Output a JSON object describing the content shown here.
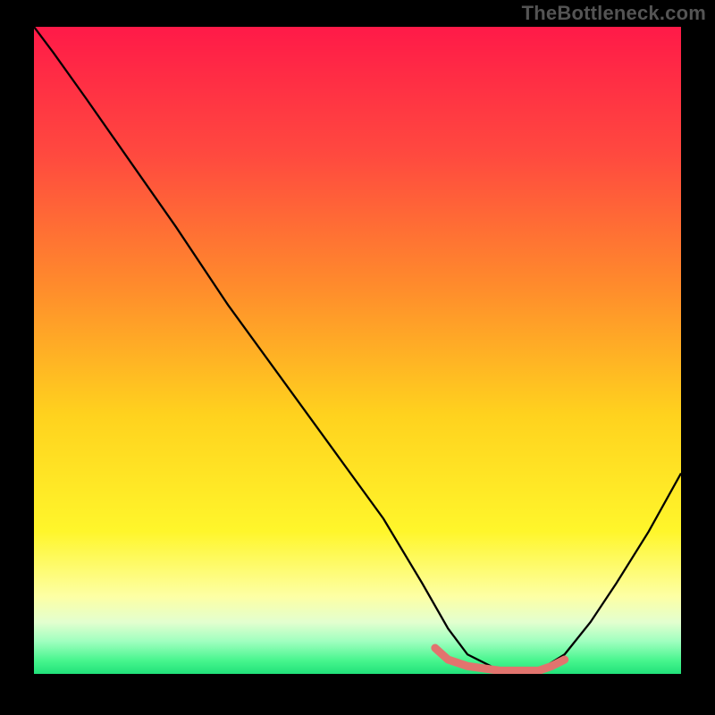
{
  "watermark": "TheBottleneck.com",
  "chart_data": {
    "type": "line",
    "title": "",
    "xlabel": "",
    "ylabel": "",
    "xlim": [
      0,
      100
    ],
    "ylim": [
      0,
      100
    ],
    "grid": false,
    "legend": false,
    "gradient_stops": [
      {
        "offset": 0,
        "color": "#ff1a48"
      },
      {
        "offset": 20,
        "color": "#ff4a3f"
      },
      {
        "offset": 40,
        "color": "#ff8b2c"
      },
      {
        "offset": 60,
        "color": "#ffd21e"
      },
      {
        "offset": 78,
        "color": "#fff62b"
      },
      {
        "offset": 88,
        "color": "#fdffa4"
      },
      {
        "offset": 92,
        "color": "#e3ffcf"
      },
      {
        "offset": 95,
        "color": "#9fffbf"
      },
      {
        "offset": 98,
        "color": "#46f58d"
      },
      {
        "offset": 100,
        "color": "#21e27a"
      }
    ],
    "series": [
      {
        "name": "bottleneck-curve",
        "color": "#000000",
        "width": 2.3,
        "x": [
          0,
          3,
          8,
          15,
          22,
          30,
          38,
          46,
          54,
          60,
          64,
          67,
          72,
          78,
          82,
          86,
          90,
          95,
          100
        ],
        "y": [
          100,
          96,
          89,
          79,
          69,
          57,
          46,
          35,
          24,
          14,
          7,
          3,
          0.5,
          0.5,
          3,
          8,
          14,
          22,
          31
        ]
      }
    ],
    "highlight_segment": {
      "name": "optimal-range",
      "color": "#e2746e",
      "width": 9,
      "x": [
        62,
        64,
        67,
        72,
        78,
        80,
        82
      ],
      "y": [
        4,
        2.2,
        1.2,
        0.5,
        0.5,
        1.2,
        2.2
      ]
    }
  }
}
